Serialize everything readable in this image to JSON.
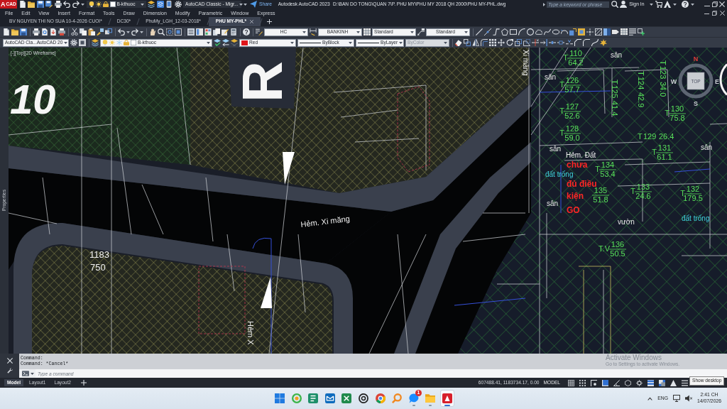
{
  "title_bar": {
    "logo": {
      "letter": "A",
      "caption": "CAD"
    },
    "layer": "B-kthuoc",
    "workspace": "AutoCAD Classic - Migr...",
    "share": "Share",
    "app_name": "Autodesk AutoCAD 2023",
    "file_path": "D:\\BAN DO TONG\\QUAN 7\\P. PHU MY\\PHU MY 2018 QH 2000\\PHU MY-PHL.dwg",
    "search": {
      "placeholder": "Type a keyword or phrase"
    },
    "sign_in": "Sign In"
  },
  "menu": [
    "File",
    "Edit",
    "View",
    "Insert",
    "Format",
    "Tools",
    "Draw",
    "Dimension",
    "Modify",
    "Parametric",
    "Window",
    "Express"
  ],
  "file_tabs": [
    {
      "label": "BV NGUYEN THI NO SUA 10-4-2026 CUOI*",
      "selected": false
    },
    {
      "label": "DC30*",
      "selected": false
    },
    {
      "label": "PhuMy_LGH_12-03-2018*",
      "selected": false
    },
    {
      "label": "PHU MY-PHL*",
      "selected": true
    }
  ],
  "styles_toolbar": {
    "text_style": "HC",
    "dimension_style": "BANKINH",
    "table_style": "Standard",
    "multileader_style": "Standard"
  },
  "properties_toolbar": {
    "workspace": "AutoCAD Cla...AutoCAD 20",
    "layer": "B-kthuoc",
    "color": {
      "label": "Red",
      "color": "#e0161b"
    },
    "linetype": "ByBlock",
    "lineweight": "ByLayer",
    "plot_style": {
      "label": "ByColor",
      "disabled": true
    }
  },
  "palette_tab": "Properties",
  "viewport": {
    "label": "[-][Top][2D Wireframe]",
    "view_cube": {
      "face": "TOP",
      "north": "N",
      "east": "E",
      "south": "S",
      "west": "W"
    }
  },
  "drawing": {
    "labels": [
      {
        "text": "10",
        "kind": "title"
      },
      {
        "text": "R",
        "kind": "title"
      },
      {
        "text": "Xi măng",
        "kind": "road"
      },
      {
        "text": "Hẻm. Xi măng",
        "kind": "road"
      },
      {
        "text": "1183",
        "kind": "coordinate"
      },
      {
        "text": "750",
        "kind": "coordinate"
      },
      {
        "text": "Hẻm X",
        "kind": "road"
      },
      {
        "text": "sân",
        "kind": "use"
      },
      {
        "text": "sân",
        "kind": "use"
      },
      {
        "text": "sân",
        "kind": "use"
      },
      {
        "text": "Hẻm. Đất",
        "kind": "road"
      },
      {
        "text": "chưa",
        "kind": "note"
      },
      {
        "text": "đất trống",
        "kind": "vacant"
      },
      {
        "text": "đủ điều",
        "kind": "note"
      },
      {
        "text": "kiện",
        "kind": "note"
      },
      {
        "text": "sân",
        "kind": "use"
      },
      {
        "text": "GO",
        "kind": "note"
      },
      {
        "text": "sân",
        "kind": "use"
      },
      {
        "text": "đất trống",
        "kind": "vacant"
      },
      {
        "text": "vườn",
        "kind": "use"
      }
    ],
    "parcels": [
      {
        "marker": "T",
        "number": "110",
        "area": "64.2"
      },
      {
        "marker": "T",
        "number": "126",
        "area": "57.7"
      },
      {
        "marker": "T",
        "number": "127",
        "area": "52.6"
      },
      {
        "marker": "T",
        "number": "128",
        "area": "59.0"
      },
      {
        "marker": "T",
        "number": "125",
        "area": "41.4"
      },
      {
        "marker": "T",
        "number": "124",
        "area": "42.9"
      },
      {
        "marker": "T",
        "number": "123",
        "area": "34.0"
      },
      {
        "marker": "T",
        "number": "130",
        "area": "75.8"
      },
      {
        "marker": "T",
        "number": "129",
        "area": "26.4"
      },
      {
        "marker": "T",
        "number": "131",
        "area": "61.1"
      },
      {
        "marker": "T",
        "number": "134",
        "area": "53.4"
      },
      {
        "number": "135",
        "area": "51.8"
      },
      {
        "marker": "T",
        "number": "133",
        "area": "24.6"
      },
      {
        "marker": "T",
        "number": "132",
        "area": "179.5"
      },
      {
        "marker": "T.V",
        "number": "136",
        "area": "50.5"
      }
    ]
  },
  "command_line": {
    "history": [
      "Command:",
      "Command: *Cancel*"
    ],
    "placeholder": "Type a command"
  },
  "layout_tabs": [
    {
      "label": "Model",
      "selected": true
    },
    {
      "label": "Layout1",
      "selected": false
    },
    {
      "label": "Layout2",
      "selected": false
    }
  ],
  "status_bar": {
    "coordinates": "607488.41, 1183734.17, 0.00",
    "space": "MODEL",
    "toggles": [
      {
        "kind": "grid",
        "on": false
      },
      {
        "kind": "snap",
        "on": false
      },
      {
        "kind": "infer",
        "on": false
      },
      {
        "kind": "ortho",
        "on": true
      },
      {
        "kind": "polar",
        "on": false
      },
      {
        "kind": "isodraft",
        "on": false
      },
      {
        "kind": "osnap",
        "on": false
      },
      {
        "kind": "lineweight",
        "on": true
      },
      {
        "kind": "transparency",
        "on": true
      },
      {
        "kind": "annotation",
        "on": false
      },
      {
        "kind": "menu",
        "on": false
      }
    ]
  },
  "tooltip": "Show desktop",
  "activation_notice": {
    "title": "Activate Windows",
    "detail": "Go to Settings to activate Windows."
  },
  "taskbar": {
    "apps": [
      {
        "kind": "start",
        "running": false,
        "active": false
      },
      {
        "kind": "ring",
        "running": false,
        "active": false
      },
      {
        "kind": "notes",
        "running": false,
        "active": false
      },
      {
        "kind": "mail",
        "running": false,
        "active": false
      },
      {
        "kind": "sheet",
        "running": false,
        "active": false
      },
      {
        "kind": "knot",
        "running": false,
        "active": false
      },
      {
        "kind": "browser",
        "running": false,
        "active": false
      },
      {
        "kind": "search",
        "running": false,
        "active": false
      },
      {
        "kind": "chat",
        "running": true,
        "active": false,
        "badge": "1"
      },
      {
        "kind": "folder",
        "running": true,
        "active": false
      },
      {
        "kind": "cad",
        "running": true,
        "active": true
      }
    ],
    "language": "ENG",
    "time": "2:41 CH",
    "date": "14/07/2026"
  }
}
